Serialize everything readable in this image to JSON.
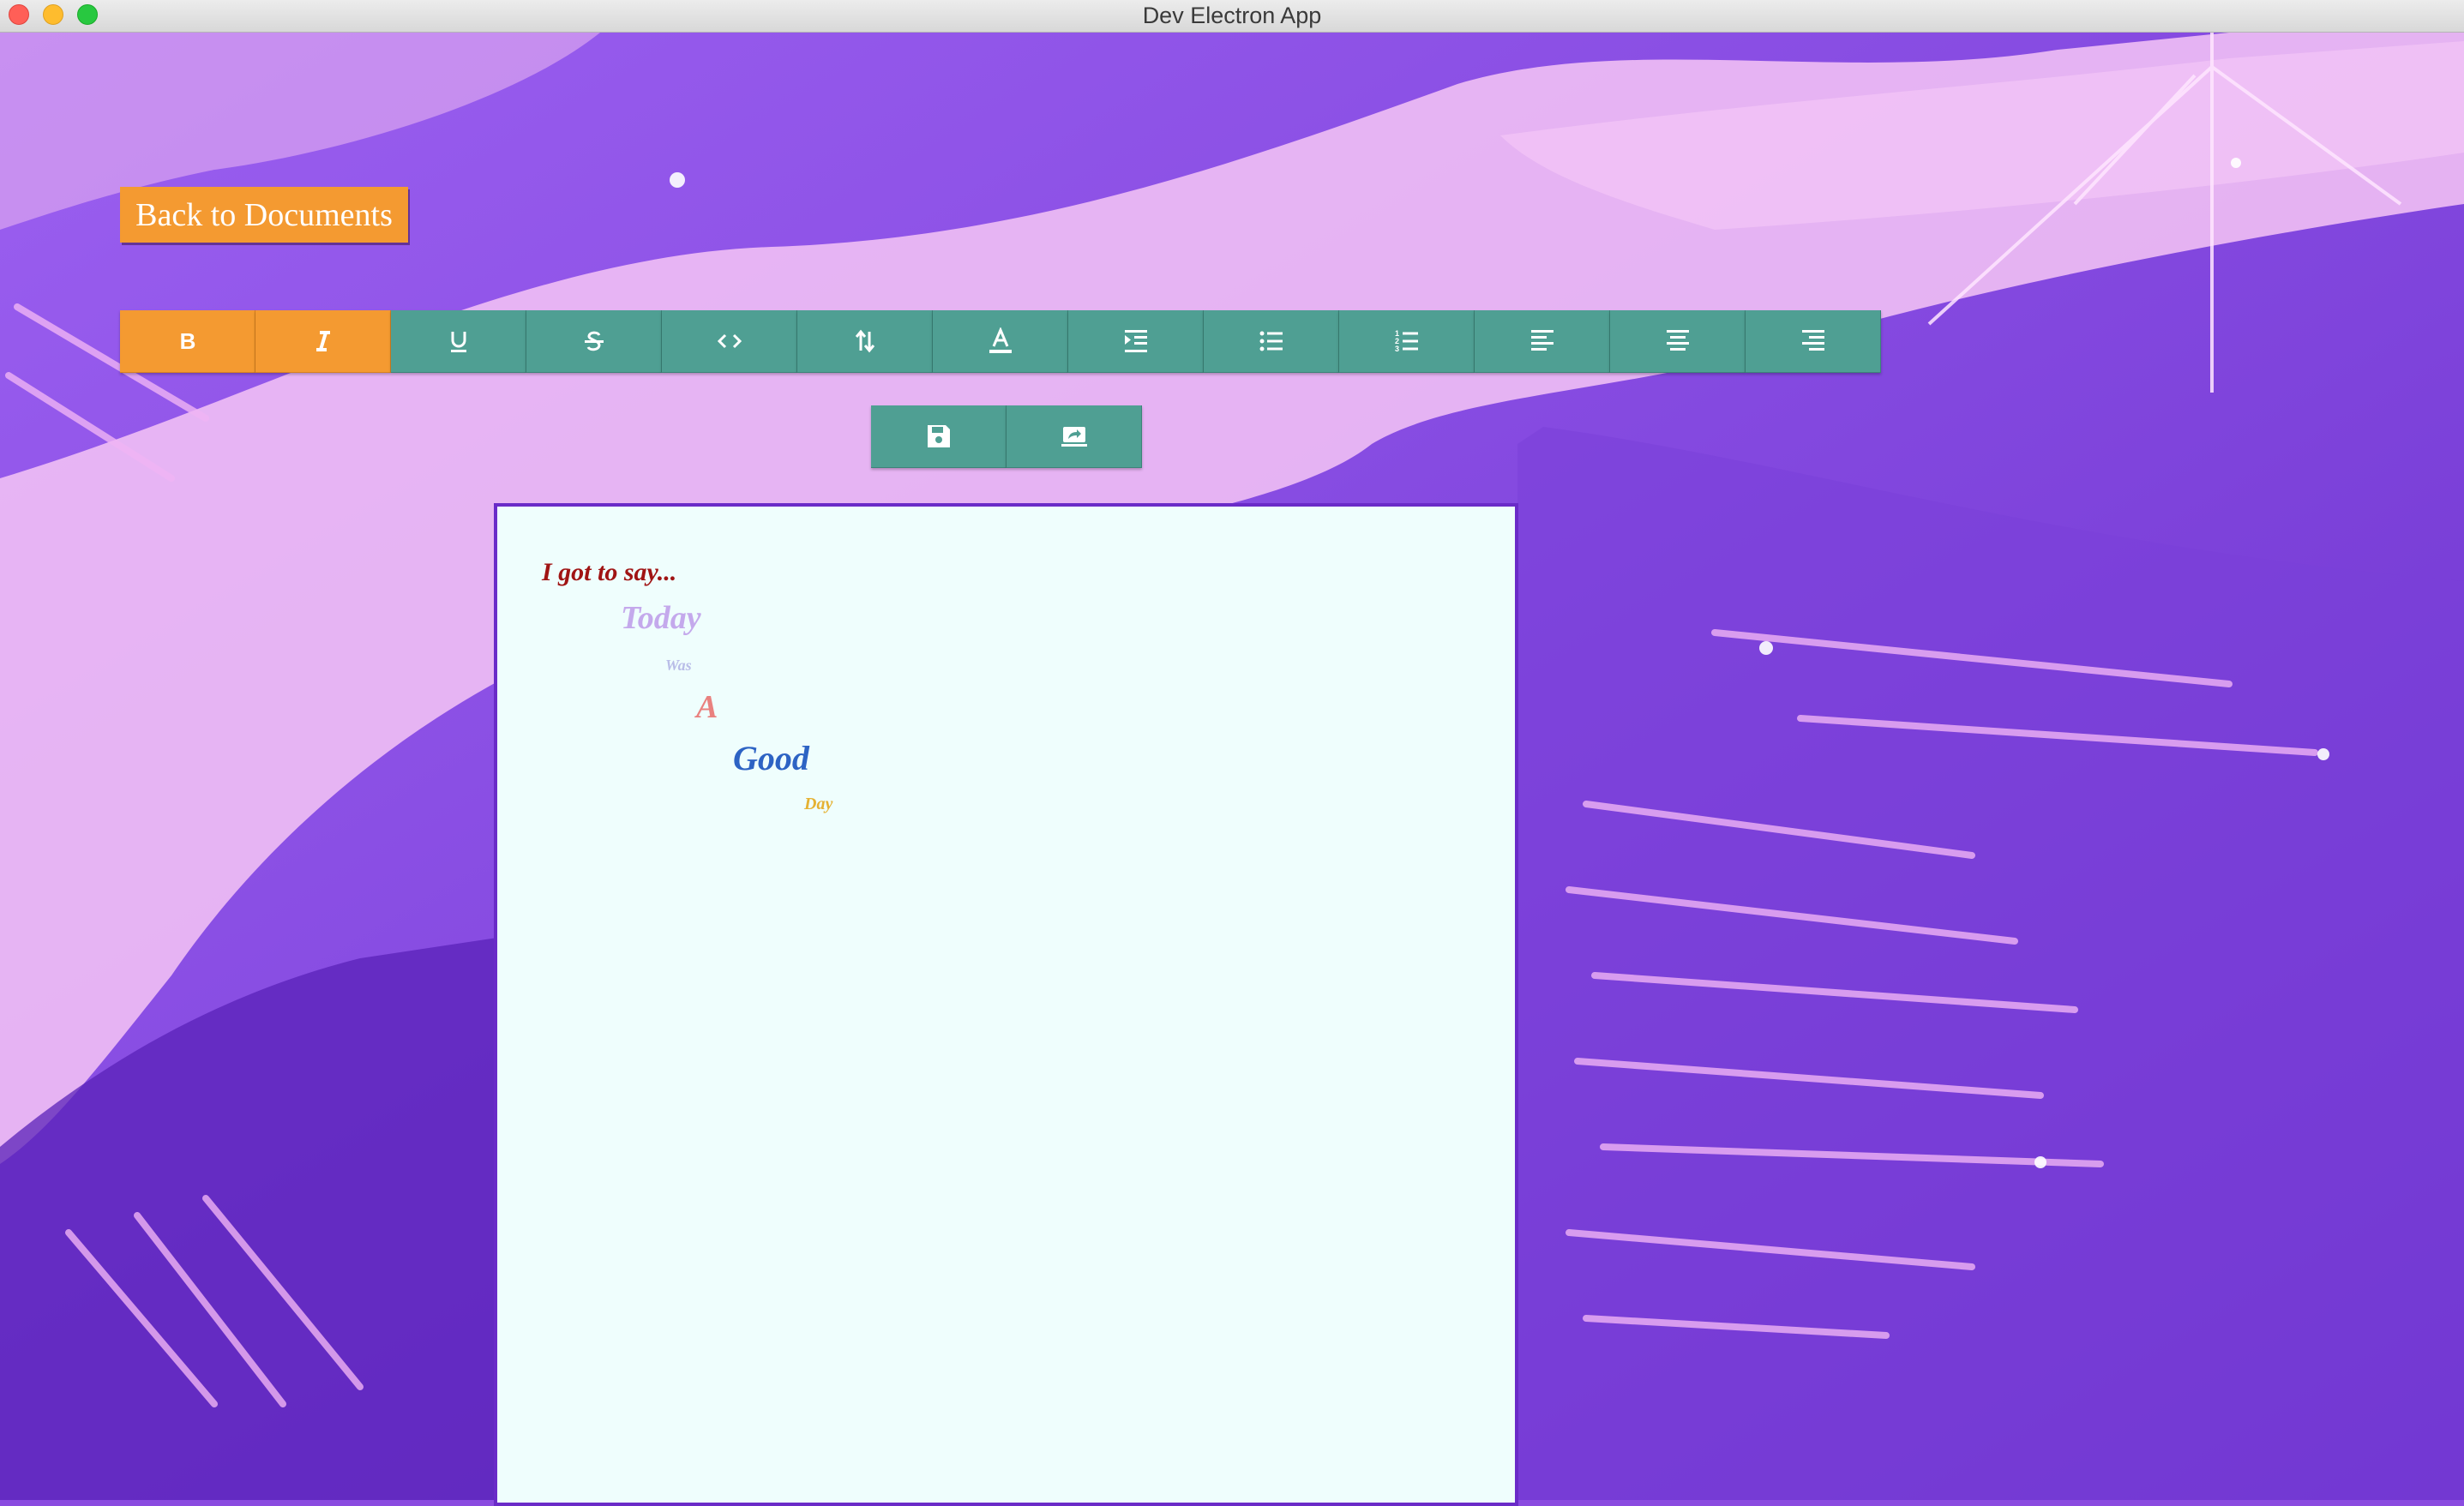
{
  "window": {
    "title": "Dev Electron App"
  },
  "nav": {
    "back_label": "Back to Documents"
  },
  "toolbar": {
    "buttons": [
      {
        "name": "bold-button",
        "icon": "bold-icon",
        "active": true
      },
      {
        "name": "italic-button",
        "icon": "italic-icon",
        "active": true
      },
      {
        "name": "underline-button",
        "icon": "underline-icon",
        "active": false
      },
      {
        "name": "strikethrough-button",
        "icon": "strikethrough-icon",
        "active": false
      },
      {
        "name": "code-button",
        "icon": "code-icon",
        "active": false
      },
      {
        "name": "font-size-button",
        "icon": "arrows-up-down-icon",
        "active": false
      },
      {
        "name": "text-color-button",
        "icon": "text-color-icon",
        "active": false
      },
      {
        "name": "indent-button",
        "icon": "indent-icon",
        "active": false
      },
      {
        "name": "bulleted-list-button",
        "icon": "list-ul-icon",
        "active": false
      },
      {
        "name": "numbered-list-button",
        "icon": "list-ol-icon",
        "active": false
      },
      {
        "name": "align-left-button",
        "icon": "align-left-icon",
        "active": false
      },
      {
        "name": "align-center-button",
        "icon": "align-center-icon",
        "active": false
      },
      {
        "name": "align-right-button",
        "icon": "align-right-icon",
        "active": false
      }
    ],
    "actions": [
      {
        "name": "save-button",
        "icon": "save-icon"
      },
      {
        "name": "share-button",
        "icon": "share-screen-icon"
      }
    ]
  },
  "document": {
    "lines": [
      {
        "text": "I got to say...",
        "color": "#a01414"
      },
      {
        "text": "Today",
        "color": "#c4a9ec"
      },
      {
        "text": "Was",
        "color": "#b9bde8"
      },
      {
        "text": "A",
        "color": "#e9817f"
      },
      {
        "text": "Good",
        "color": "#2d63c4"
      },
      {
        "text": "Day",
        "color": "#e5b233"
      }
    ]
  },
  "colors": {
    "accent_orange": "#f49a31",
    "toolbar_teal": "#4f9f93",
    "editor_bg": "#effefd",
    "editor_border": "#6a2bc8"
  }
}
